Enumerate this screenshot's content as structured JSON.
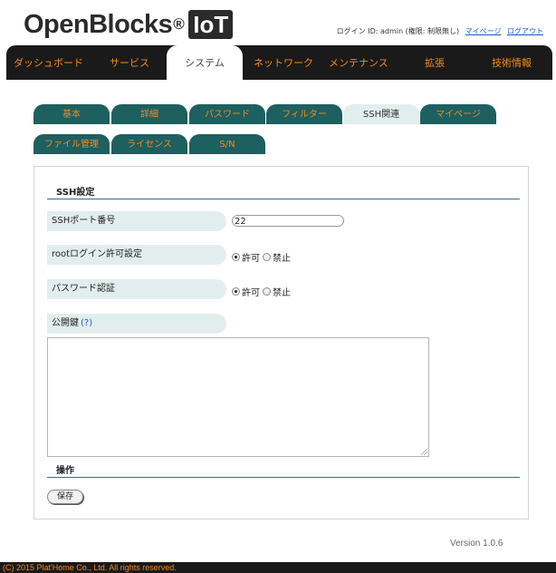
{
  "brand": {
    "name": "OpenBlocks",
    "reg": "®",
    "badge": "IoT"
  },
  "login": {
    "info": "ログイン ID: admin (権限: 制限無し)",
    "mypage_link": "マイページ",
    "logout_link": "ログアウト"
  },
  "mainnav": {
    "items": [
      "ダッシュボード",
      "サービス",
      "システム",
      "ネットワーク",
      "メンテナンス",
      "拡張",
      "技術情報"
    ],
    "active": "システム"
  },
  "tabs": {
    "row1": [
      "基本",
      "詳細",
      "パスワード",
      "フィルター",
      "SSH関連",
      "マイページ"
    ],
    "row2": [
      "ファイル管理",
      "ライセンス",
      "S/N"
    ],
    "active": "SSH関連"
  },
  "ssh": {
    "section_title": "SSH設定",
    "port_label": "SSHポート番号",
    "port_value": "22",
    "root_login_label": "rootログイン許可設定",
    "password_auth_label": "パスワード認証",
    "allow": "許可",
    "deny": "禁止",
    "root_login_selected": "許可",
    "password_auth_selected": "許可",
    "pubkey_label": "公開鍵",
    "pubkey_help": "(?)",
    "pubkey_value": ""
  },
  "ops": {
    "section_title": "操作",
    "save_label": "保存"
  },
  "version": "Version 1.0.6",
  "footer": "(C) 2015 Plat'Home Co., Ltd. All rights reserved.",
  "colors": {
    "nav_bg": "#1a1a1a",
    "accent_orange": "#f58a1f",
    "tab_teal": "#1e5f5f",
    "label_bg": "#e2eeed",
    "link_blue": "#2255cc"
  }
}
